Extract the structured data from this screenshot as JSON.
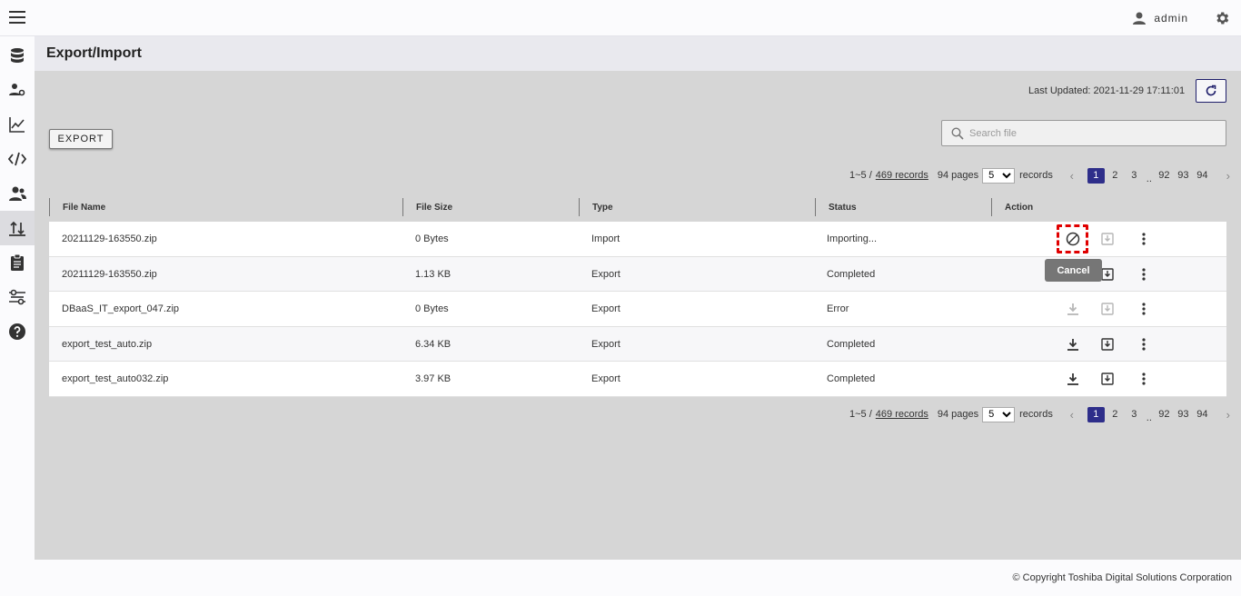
{
  "header": {
    "user_name": "admin"
  },
  "page": {
    "title": "Export/Import"
  },
  "toolbar": {
    "last_updated_label": "Last Updated: 2021-11-29 17:11:01",
    "export_label": "EXPORT",
    "search_placeholder": "Search file"
  },
  "pagination": {
    "range": "1~5 /",
    "records_link": "469 records",
    "pages_label": "94 pages",
    "page_size": "5",
    "records_label": "records",
    "pages": [
      "1",
      "2",
      "3",
      "92",
      "93",
      "94"
    ],
    "dots": "..",
    "current_page": "1"
  },
  "table": {
    "columns": [
      "File Name",
      "File Size",
      "Type",
      "Status",
      "Action"
    ],
    "rows": [
      {
        "file_name": "20211129-163550.zip",
        "file_size": "0 Bytes",
        "type": "Import",
        "status": "Importing..."
      },
      {
        "file_name": "20211129-163550.zip",
        "file_size": "1.13 KB",
        "type": "Export",
        "status": "Completed"
      },
      {
        "file_name": "DBaaS_IT_export_047.zip",
        "file_size": "0 Bytes",
        "type": "Export",
        "status": "Error"
      },
      {
        "file_name": "export_test_auto.zip",
        "file_size": "6.34 KB",
        "type": "Export",
        "status": "Completed"
      },
      {
        "file_name": "export_test_auto032.zip",
        "file_size": "3.97 KB",
        "type": "Export",
        "status": "Completed"
      }
    ]
  },
  "tooltip": {
    "text": "Cancel"
  },
  "footer": {
    "copyright": "© Copyright Toshiba Digital Solutions Corporation"
  },
  "colors": {
    "accent": "#2e2e8a",
    "highlight": "#e00000",
    "background": "#d6d6d6"
  },
  "icons": [
    "menu-icon",
    "user-icon",
    "gear-icon",
    "database-icon",
    "user-settings-icon",
    "chart-icon",
    "code-icon",
    "users-icon",
    "export-import-icon",
    "clipboard-icon",
    "settings-sliders-icon",
    "help-icon",
    "refresh-icon",
    "search-icon",
    "cancel-icon",
    "download-icon",
    "save-icon",
    "more-vertical-icon"
  ]
}
